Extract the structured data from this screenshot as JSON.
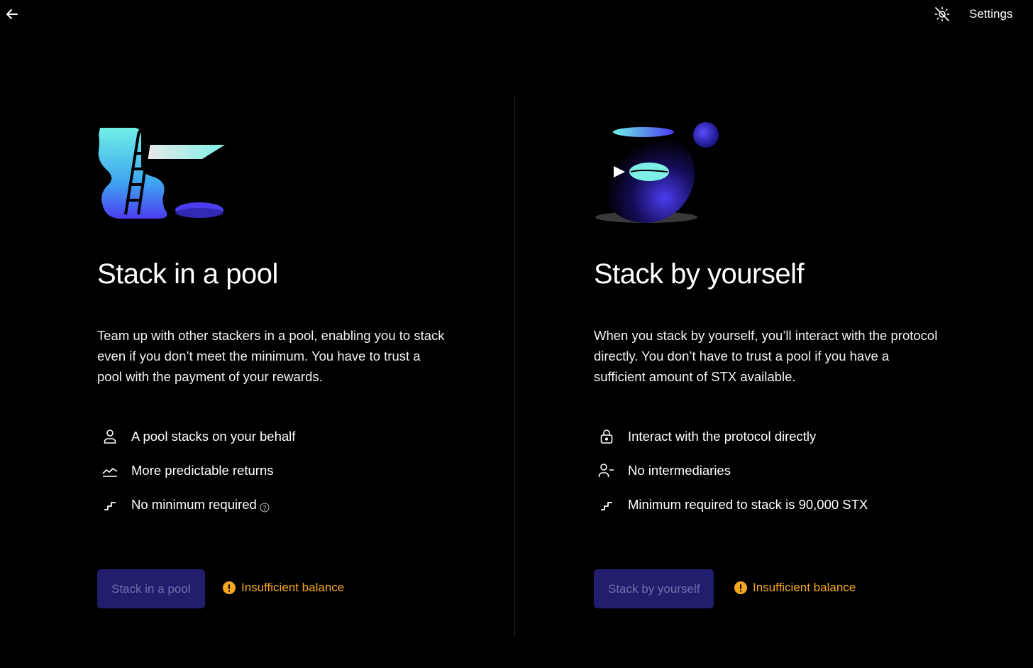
{
  "header": {
    "back_icon": "arrow-left-icon",
    "theme_icon": "sun-slash-icon",
    "settings_label": "Settings"
  },
  "pool": {
    "illustration": "pool-ladder-illustration",
    "title": "Stack in a pool",
    "description": "Team up with other stackers in a pool, enabling you to stack even if you don’t meet the minimum. You have to trust a pool with the payment of your rewards.",
    "features": [
      {
        "icon": "user-icon",
        "label": "A pool stacks on your behalf"
      },
      {
        "icon": "chart-line-icon",
        "label": "More predictable returns"
      },
      {
        "icon": "stairs-icon",
        "label": "No minimum required",
        "help_icon": "question-circle-icon"
      }
    ],
    "button_label": "Stack in a pool",
    "warning_icon": "exclamation-circle-icon",
    "warning_text": "Insufficient balance"
  },
  "solo": {
    "illustration": "fish-bowl-illustration",
    "title": "Stack by yourself",
    "description": "When you stack by yourself, you’ll interact with the protocol directly. You don’t have to trust a pool if you have a sufficient amount of STX available.",
    "features": [
      {
        "icon": "lock-icon",
        "label": "Interact with the protocol directly"
      },
      {
        "icon": "user-minus-icon",
        "label": "No intermediaries"
      },
      {
        "icon": "stairs-icon",
        "label": "Minimum required to stack is 90,000 STX"
      }
    ],
    "button_label": "Stack by yourself",
    "warning_icon": "exclamation-circle-icon",
    "warning_text": "Insufficient balance"
  },
  "colors": {
    "background": "#000000",
    "button_bg": "#221e6e",
    "button_text": "#726ea8",
    "warning": "#f5a623",
    "accent_blue": "#4b3cf0",
    "accent_cyan": "#5fe3e0"
  }
}
